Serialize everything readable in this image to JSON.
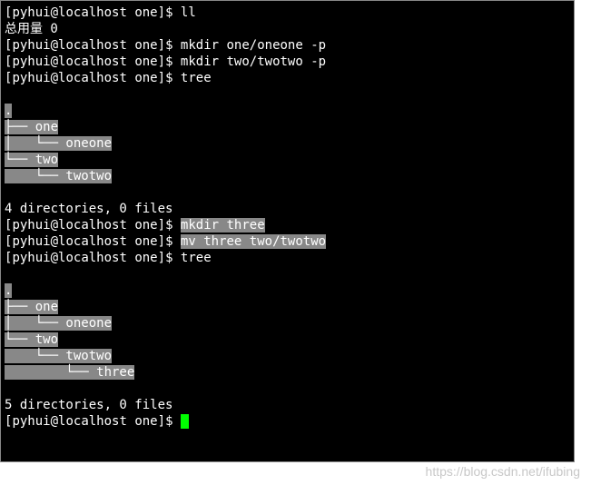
{
  "prompt": {
    "user": "pyhui",
    "host": "localhost",
    "dir": "one",
    "sep": "$ "
  },
  "lines": {
    "l1_cmd": "ll",
    "l2": "总用量 0",
    "l3_cmd": "mkdir one/oneone -p",
    "l4_cmd": "mkdir two/twotwo -p",
    "l5_cmd": "tree",
    "tree1_dot": ".",
    "tree1_a": "├── one",
    "tree1_b": "│   └── oneone",
    "tree1_c": "└── two",
    "tree1_d": "    └── twotwo",
    "summary1": "4 directories, 0 files",
    "l6_cmd": "mkdir three",
    "l7_cmd": "mv three two/twotwo",
    "l8_cmd": "tree",
    "tree2_dot": ".",
    "tree2_a": "├── one",
    "tree2_b": "│   └── oneone",
    "tree2_c": "└── two",
    "tree2_d": "    └── twotwo",
    "tree2_e": "        └── three",
    "summary2": "5 directories, 0 files"
  },
  "watermark": "https://blog.csdn.net/ifubing"
}
